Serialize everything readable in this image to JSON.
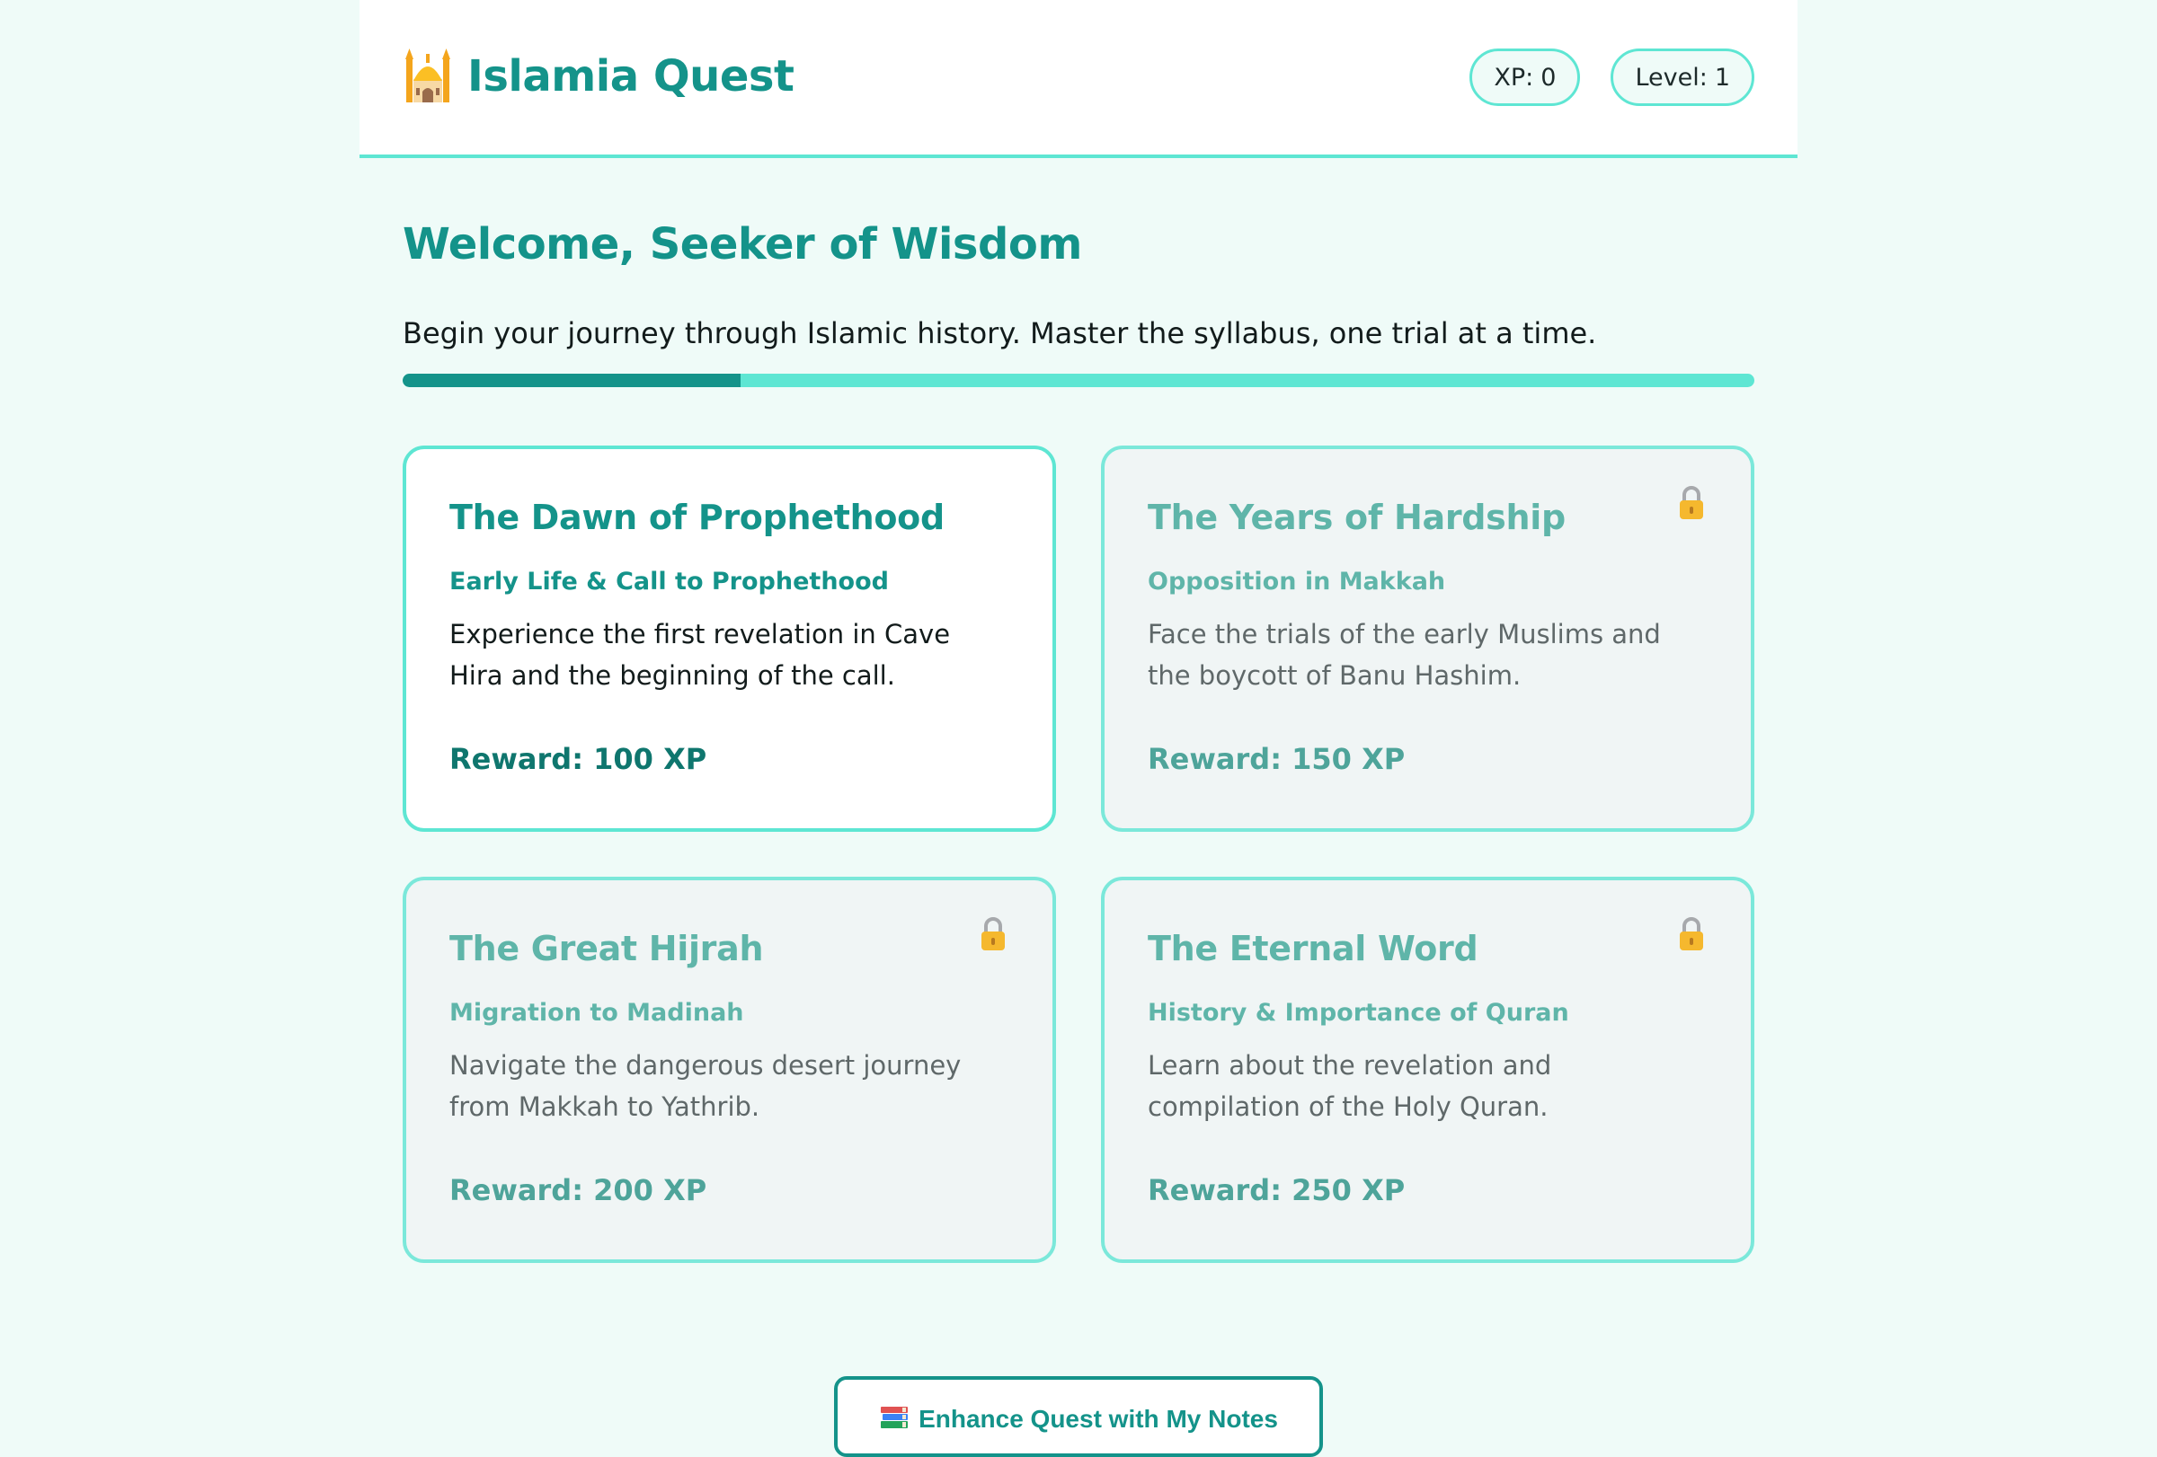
{
  "app": {
    "title": "Islamia Quest",
    "logo_icon": "mosque-icon"
  },
  "stats": {
    "xp_label": "XP:",
    "xp_value": "0",
    "level_label": "Level:",
    "level_value": "1"
  },
  "welcome": {
    "heading": "Welcome, Seeker of Wisdom",
    "intro": "Begin your journey through Islamic history. Master the syllabus, one trial at a time.",
    "progress_fraction": 0.25
  },
  "quests": [
    {
      "title": "The Dawn of Prophethood",
      "subtitle": "Early Life & Call to Prophethood",
      "description": "Experience the first revelation in Cave Hira and the beginning of the call.",
      "reward": "Reward: 100 XP",
      "locked": false
    },
    {
      "title": "The Years of Hardship",
      "subtitle": "Opposition in Makkah",
      "description": "Face the trials of the early Muslims and the boycott of Banu Hashim.",
      "reward": "Reward: 150 XP",
      "locked": true
    },
    {
      "title": "The Great Hijrah",
      "subtitle": "Migration to Madinah",
      "description": "Navigate the dangerous desert journey from Makkah to Yathrib.",
      "reward": "Reward: 200 XP",
      "locked": true
    },
    {
      "title": "The Eternal Word",
      "subtitle": "History & Importance of Quran",
      "description": "Learn about the revelation and compilation of the Holy Quran.",
      "reward": "Reward: 250 XP",
      "locked": true
    }
  ],
  "notes_button": {
    "label": "Enhance Quest with My Notes",
    "icon": "books-icon"
  },
  "colors": {
    "accent": "#14938a",
    "accent_light": "#5ee6d3",
    "page_background": "#effbf8",
    "locked_card": "#f0f5f5"
  }
}
